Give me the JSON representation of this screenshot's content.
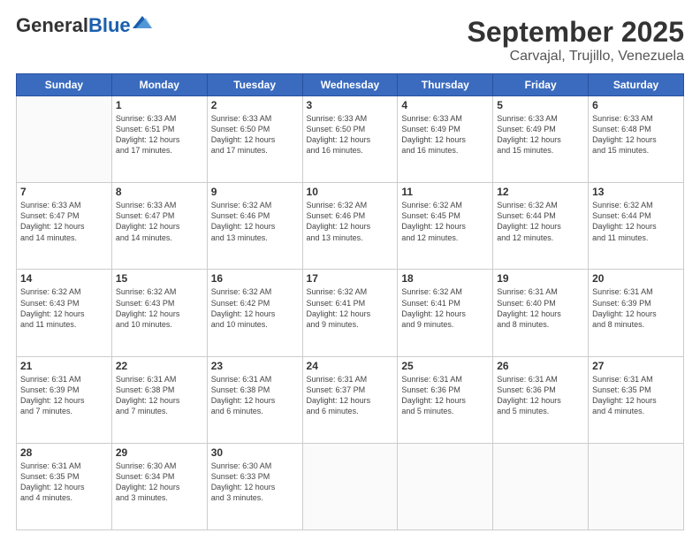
{
  "header": {
    "logo_general": "General",
    "logo_blue": "Blue",
    "title": "September 2025",
    "subtitle": "Carvajal, Trujillo, Venezuela"
  },
  "days_of_week": [
    "Sunday",
    "Monday",
    "Tuesday",
    "Wednesday",
    "Thursday",
    "Friday",
    "Saturday"
  ],
  "weeks": [
    [
      {
        "day": "",
        "info": ""
      },
      {
        "day": "1",
        "info": "Sunrise: 6:33 AM\nSunset: 6:51 PM\nDaylight: 12 hours\nand 17 minutes."
      },
      {
        "day": "2",
        "info": "Sunrise: 6:33 AM\nSunset: 6:50 PM\nDaylight: 12 hours\nand 17 minutes."
      },
      {
        "day": "3",
        "info": "Sunrise: 6:33 AM\nSunset: 6:50 PM\nDaylight: 12 hours\nand 16 minutes."
      },
      {
        "day": "4",
        "info": "Sunrise: 6:33 AM\nSunset: 6:49 PM\nDaylight: 12 hours\nand 16 minutes."
      },
      {
        "day": "5",
        "info": "Sunrise: 6:33 AM\nSunset: 6:49 PM\nDaylight: 12 hours\nand 15 minutes."
      },
      {
        "day": "6",
        "info": "Sunrise: 6:33 AM\nSunset: 6:48 PM\nDaylight: 12 hours\nand 15 minutes."
      }
    ],
    [
      {
        "day": "7",
        "info": "Sunrise: 6:33 AM\nSunset: 6:47 PM\nDaylight: 12 hours\nand 14 minutes."
      },
      {
        "day": "8",
        "info": "Sunrise: 6:33 AM\nSunset: 6:47 PM\nDaylight: 12 hours\nand 14 minutes."
      },
      {
        "day": "9",
        "info": "Sunrise: 6:32 AM\nSunset: 6:46 PM\nDaylight: 12 hours\nand 13 minutes."
      },
      {
        "day": "10",
        "info": "Sunrise: 6:32 AM\nSunset: 6:46 PM\nDaylight: 12 hours\nand 13 minutes."
      },
      {
        "day": "11",
        "info": "Sunrise: 6:32 AM\nSunset: 6:45 PM\nDaylight: 12 hours\nand 12 minutes."
      },
      {
        "day": "12",
        "info": "Sunrise: 6:32 AM\nSunset: 6:44 PM\nDaylight: 12 hours\nand 12 minutes."
      },
      {
        "day": "13",
        "info": "Sunrise: 6:32 AM\nSunset: 6:44 PM\nDaylight: 12 hours\nand 11 minutes."
      }
    ],
    [
      {
        "day": "14",
        "info": "Sunrise: 6:32 AM\nSunset: 6:43 PM\nDaylight: 12 hours\nand 11 minutes."
      },
      {
        "day": "15",
        "info": "Sunrise: 6:32 AM\nSunset: 6:43 PM\nDaylight: 12 hours\nand 10 minutes."
      },
      {
        "day": "16",
        "info": "Sunrise: 6:32 AM\nSunset: 6:42 PM\nDaylight: 12 hours\nand 10 minutes."
      },
      {
        "day": "17",
        "info": "Sunrise: 6:32 AM\nSunset: 6:41 PM\nDaylight: 12 hours\nand 9 minutes."
      },
      {
        "day": "18",
        "info": "Sunrise: 6:32 AM\nSunset: 6:41 PM\nDaylight: 12 hours\nand 9 minutes."
      },
      {
        "day": "19",
        "info": "Sunrise: 6:31 AM\nSunset: 6:40 PM\nDaylight: 12 hours\nand 8 minutes."
      },
      {
        "day": "20",
        "info": "Sunrise: 6:31 AM\nSunset: 6:39 PM\nDaylight: 12 hours\nand 8 minutes."
      }
    ],
    [
      {
        "day": "21",
        "info": "Sunrise: 6:31 AM\nSunset: 6:39 PM\nDaylight: 12 hours\nand 7 minutes."
      },
      {
        "day": "22",
        "info": "Sunrise: 6:31 AM\nSunset: 6:38 PM\nDaylight: 12 hours\nand 7 minutes."
      },
      {
        "day": "23",
        "info": "Sunrise: 6:31 AM\nSunset: 6:38 PM\nDaylight: 12 hours\nand 6 minutes."
      },
      {
        "day": "24",
        "info": "Sunrise: 6:31 AM\nSunset: 6:37 PM\nDaylight: 12 hours\nand 6 minutes."
      },
      {
        "day": "25",
        "info": "Sunrise: 6:31 AM\nSunset: 6:36 PM\nDaylight: 12 hours\nand 5 minutes."
      },
      {
        "day": "26",
        "info": "Sunrise: 6:31 AM\nSunset: 6:36 PM\nDaylight: 12 hours\nand 5 minutes."
      },
      {
        "day": "27",
        "info": "Sunrise: 6:31 AM\nSunset: 6:35 PM\nDaylight: 12 hours\nand 4 minutes."
      }
    ],
    [
      {
        "day": "28",
        "info": "Sunrise: 6:31 AM\nSunset: 6:35 PM\nDaylight: 12 hours\nand 4 minutes."
      },
      {
        "day": "29",
        "info": "Sunrise: 6:30 AM\nSunset: 6:34 PM\nDaylight: 12 hours\nand 3 minutes."
      },
      {
        "day": "30",
        "info": "Sunrise: 6:30 AM\nSunset: 6:33 PM\nDaylight: 12 hours\nand 3 minutes."
      },
      {
        "day": "",
        "info": ""
      },
      {
        "day": "",
        "info": ""
      },
      {
        "day": "",
        "info": ""
      },
      {
        "day": "",
        "info": ""
      }
    ]
  ]
}
